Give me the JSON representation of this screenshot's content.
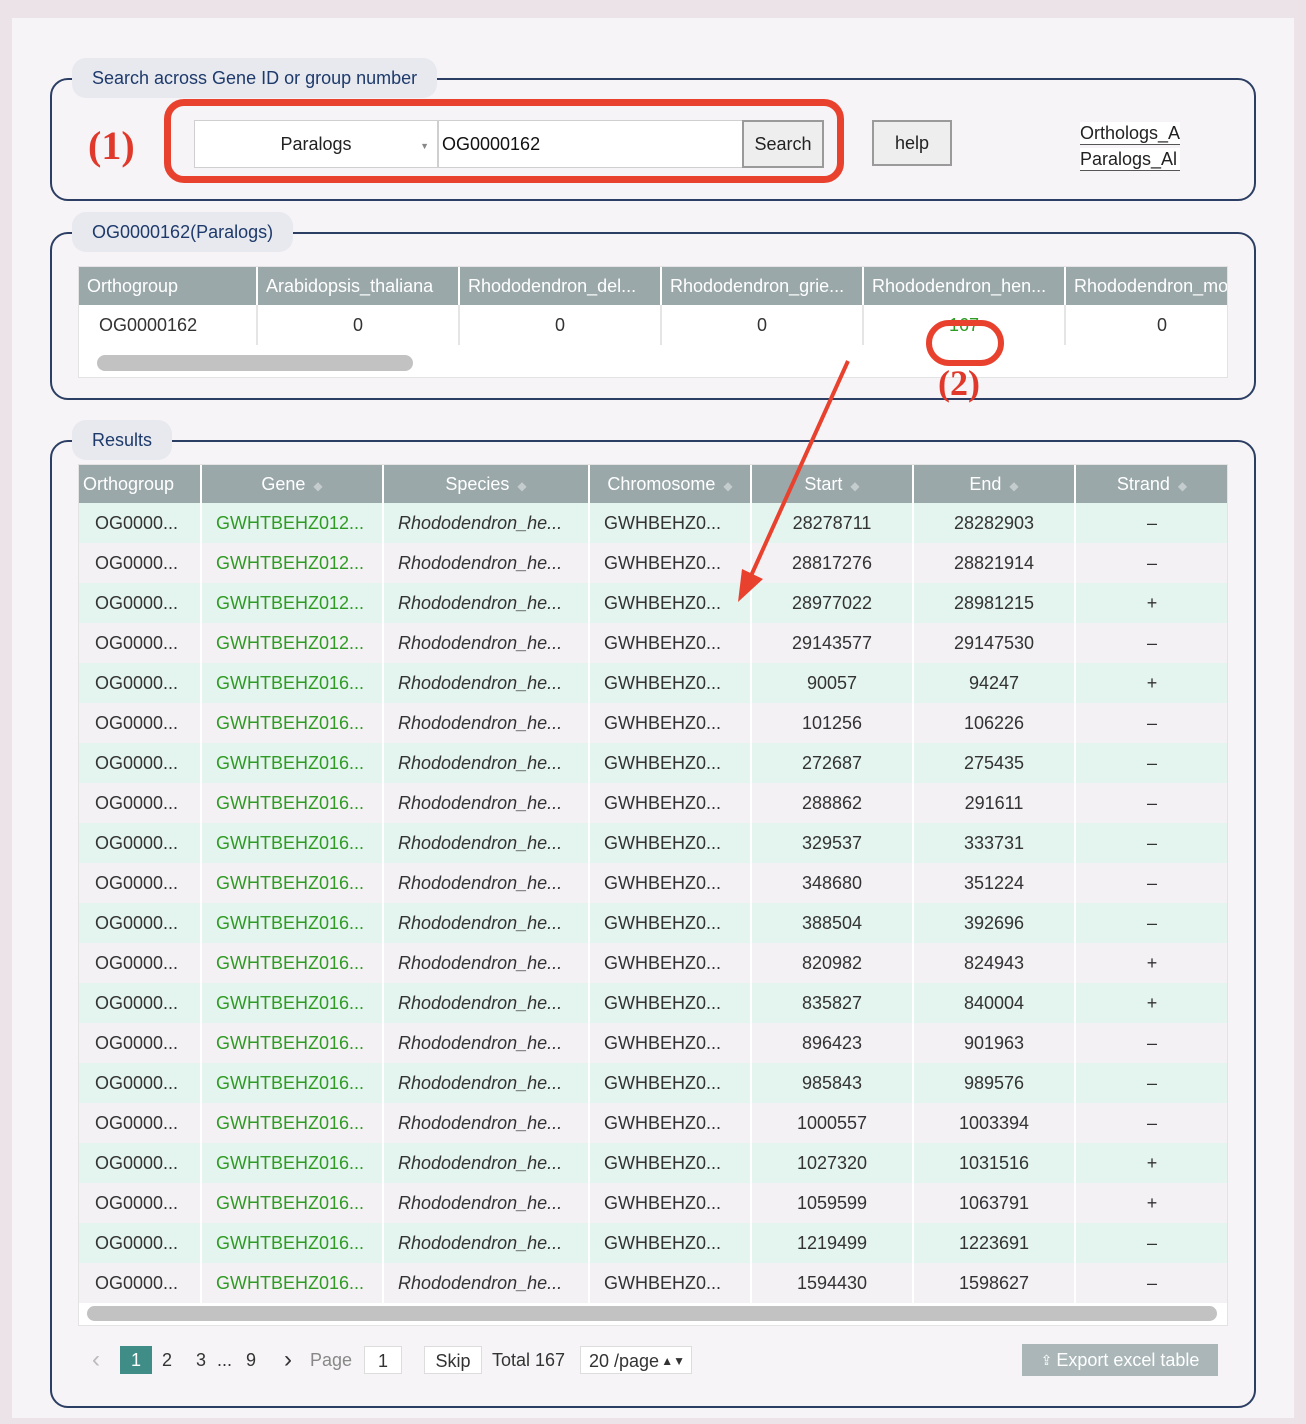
{
  "search": {
    "legend": "Search across Gene ID or group number",
    "annotation": "(1)",
    "select_value": "Paralogs",
    "input_value": "OG0000162",
    "search_label": "Search",
    "help_label": "help",
    "download_links": [
      "Orthologs_A",
      "Paralogs_Al"
    ]
  },
  "group": {
    "legend": "OG0000162(Paralogs)",
    "annotation": "(2)",
    "columns": [
      "Orthogroup",
      "Arabidopsis_thaliana",
      "Rhododendron_del...",
      "Rhododendron_grie...",
      "Rhododendron_hen...",
      "Rhododendron_mo"
    ],
    "row": [
      "OG0000162",
      "0",
      "0",
      "0",
      "167",
      "0"
    ]
  },
  "results": {
    "legend": "Results",
    "columns": [
      "Orthogroup",
      "Gene",
      "Species",
      "Chromosome",
      "Start",
      "End",
      "Strand"
    ],
    "rows": [
      [
        "OG0000...",
        "GWHTBEHZ012...",
        "Rhododendron_he...",
        "GWHBEHZ0...",
        "28278711",
        "28282903",
        "–"
      ],
      [
        "OG0000...",
        "GWHTBEHZ012...",
        "Rhododendron_he...",
        "GWHBEHZ0...",
        "28817276",
        "28821914",
        "–"
      ],
      [
        "OG0000...",
        "GWHTBEHZ012...",
        "Rhododendron_he...",
        "GWHBEHZ0...",
        "28977022",
        "28981215",
        "+"
      ],
      [
        "OG0000...",
        "GWHTBEHZ012...",
        "Rhododendron_he...",
        "GWHBEHZ0...",
        "29143577",
        "29147530",
        "–"
      ],
      [
        "OG0000...",
        "GWHTBEHZ016...",
        "Rhododendron_he...",
        "GWHBEHZ0...",
        "90057",
        "94247",
        "+"
      ],
      [
        "OG0000...",
        "GWHTBEHZ016...",
        "Rhododendron_he...",
        "GWHBEHZ0...",
        "101256",
        "106226",
        "–"
      ],
      [
        "OG0000...",
        "GWHTBEHZ016...",
        "Rhododendron_he...",
        "GWHBEHZ0...",
        "272687",
        "275435",
        "–"
      ],
      [
        "OG0000...",
        "GWHTBEHZ016...",
        "Rhododendron_he...",
        "GWHBEHZ0...",
        "288862",
        "291611",
        "–"
      ],
      [
        "OG0000...",
        "GWHTBEHZ016...",
        "Rhododendron_he...",
        "GWHBEHZ0...",
        "329537",
        "333731",
        "–"
      ],
      [
        "OG0000...",
        "GWHTBEHZ016...",
        "Rhododendron_he...",
        "GWHBEHZ0...",
        "348680",
        "351224",
        "–"
      ],
      [
        "OG0000...",
        "GWHTBEHZ016...",
        "Rhododendron_he...",
        "GWHBEHZ0...",
        "388504",
        "392696",
        "–"
      ],
      [
        "OG0000...",
        "GWHTBEHZ016...",
        "Rhododendron_he...",
        "GWHBEHZ0...",
        "820982",
        "824943",
        "+"
      ],
      [
        "OG0000...",
        "GWHTBEHZ016...",
        "Rhododendron_he...",
        "GWHBEHZ0...",
        "835827",
        "840004",
        "+"
      ],
      [
        "OG0000...",
        "GWHTBEHZ016...",
        "Rhododendron_he...",
        "GWHBEHZ0...",
        "896423",
        "901963",
        "–"
      ],
      [
        "OG0000...",
        "GWHTBEHZ016...",
        "Rhododendron_he...",
        "GWHBEHZ0...",
        "985843",
        "989576",
        "–"
      ],
      [
        "OG0000...",
        "GWHTBEHZ016...",
        "Rhododendron_he...",
        "GWHBEHZ0...",
        "1000557",
        "1003394",
        "–"
      ],
      [
        "OG0000...",
        "GWHTBEHZ016...",
        "Rhododendron_he...",
        "GWHBEHZ0...",
        "1027320",
        "1031516",
        "+"
      ],
      [
        "OG0000...",
        "GWHTBEHZ016...",
        "Rhododendron_he...",
        "GWHBEHZ0...",
        "1059599",
        "1063791",
        "+"
      ],
      [
        "OG0000...",
        "GWHTBEHZ016...",
        "Rhododendron_he...",
        "GWHBEHZ0...",
        "1219499",
        "1223691",
        "–"
      ],
      [
        "OG0000...",
        "GWHTBEHZ016...",
        "Rhododendron_he...",
        "GWHBEHZ0...",
        "1594430",
        "1598627",
        "–"
      ]
    ]
  },
  "pagination": {
    "prev": "‹",
    "pages": [
      "1",
      "2",
      "3",
      "...",
      "9"
    ],
    "next": "›",
    "page_label": "Page",
    "page_input": "1",
    "skip_label": "Skip",
    "total_label": "Total 167",
    "page_size": "20 /page",
    "export_label": "Export excel table"
  },
  "colors": {
    "accent_green": "#2f9b24",
    "annotation_red": "#e8422f",
    "header_gray": "#9aa8aa",
    "row_mint": "#e4f4ef",
    "page_active": "#3f8d86"
  }
}
